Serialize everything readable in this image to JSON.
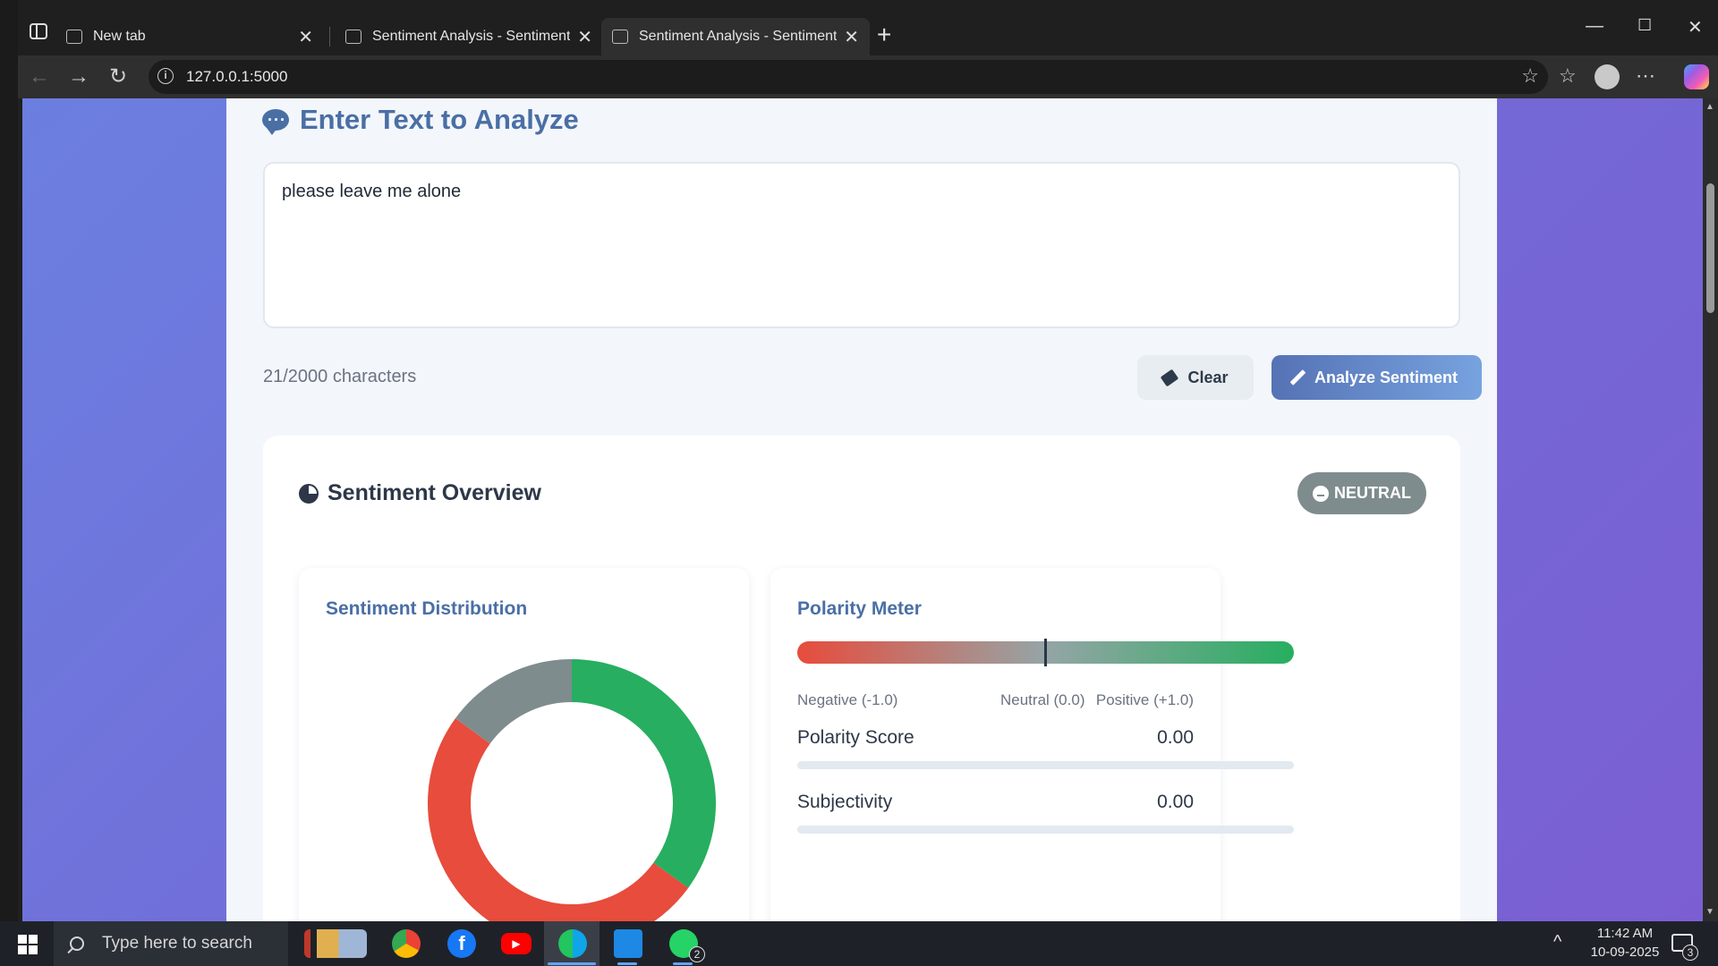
{
  "browser": {
    "tabs": [
      {
        "label": "New tab",
        "active": false
      },
      {
        "label": "Sentiment Analysis - SentimentPro",
        "active": false
      },
      {
        "label": "Sentiment Analysis - SentimentPro",
        "active": true
      }
    ],
    "url": "127.0.0.1:5000"
  },
  "input_section": {
    "title": "Enter Text to Analyze",
    "text": "please leave me alone",
    "char_count": "21/2000 characters",
    "clear_label": "Clear",
    "analyze_label": "Analyze Sentiment"
  },
  "overview": {
    "title": "Sentiment Overview",
    "badge": "NEUTRAL",
    "badge_color": "#7f8c8d"
  },
  "distribution": {
    "title": "Sentiment Distribution",
    "chart_data": {
      "type": "pie",
      "series": [
        {
          "value": 0.35,
          "color": "#27ae60"
        },
        {
          "value": 0.5,
          "color": "#e74c3c"
        },
        {
          "value": 0.15,
          "color": "#7f8c8d"
        }
      ]
    }
  },
  "polarity": {
    "title": "Polarity Meter",
    "needle_value": 0.0,
    "label_negative": "Negative (-1.0)",
    "label_neutral": "Neutral (0.0)",
    "label_positive": "Positive (+1.0)",
    "score_label": "Polarity Score",
    "score_value": "0.00",
    "score_fill": 0,
    "subjectivity_label": "Subjectivity",
    "subjectivity_value": "0.00",
    "subjectivity_fill": 0
  },
  "taskbar": {
    "search_placeholder": "Type here to search",
    "time": "11:42 AM",
    "date": "10-09-2025",
    "whatsapp_badge": "2",
    "notification_count": "3"
  }
}
